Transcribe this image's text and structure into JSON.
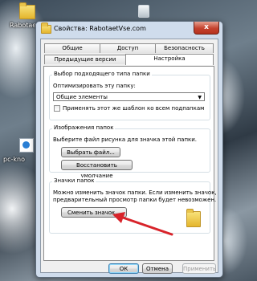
{
  "desktop": {
    "icon1_label": "Rabotaet",
    "icon2_label": "pc-kno"
  },
  "window": {
    "title": "Свойства: RabotaetVse.com",
    "close_label": "x"
  },
  "tabs": {
    "row1": [
      "Общие",
      "Доступ",
      "Безопасность"
    ],
    "row2": [
      "Предыдущие версии",
      "Настройка"
    ],
    "active": "Настройка"
  },
  "optimize_group": {
    "title": "Выбор подходящего типа папки",
    "prompt": "Оптимизировать эту папку:",
    "selected": "Общие элементы",
    "checkbox_label": "Применять этот же шаблон ко всем подпапкам"
  },
  "images_group": {
    "title": "Изображения папок",
    "prompt": "Выберите файл рисунка для значка этой папки.",
    "choose_file": "Выбрать файл...",
    "restore_default": "Восстановить умолчание"
  },
  "icons_group": {
    "title": "Значки папок",
    "line1": "Можно изменить значок папки. Если изменить значок,",
    "line2": "предварительный просмотр папки будет невозможен.",
    "change_icon": "Сменить значок..."
  },
  "footer": {
    "ok": "ОК",
    "cancel": "Отмена",
    "apply": "Применить"
  },
  "colors": {
    "annotation_arrow": "#d8232a"
  }
}
